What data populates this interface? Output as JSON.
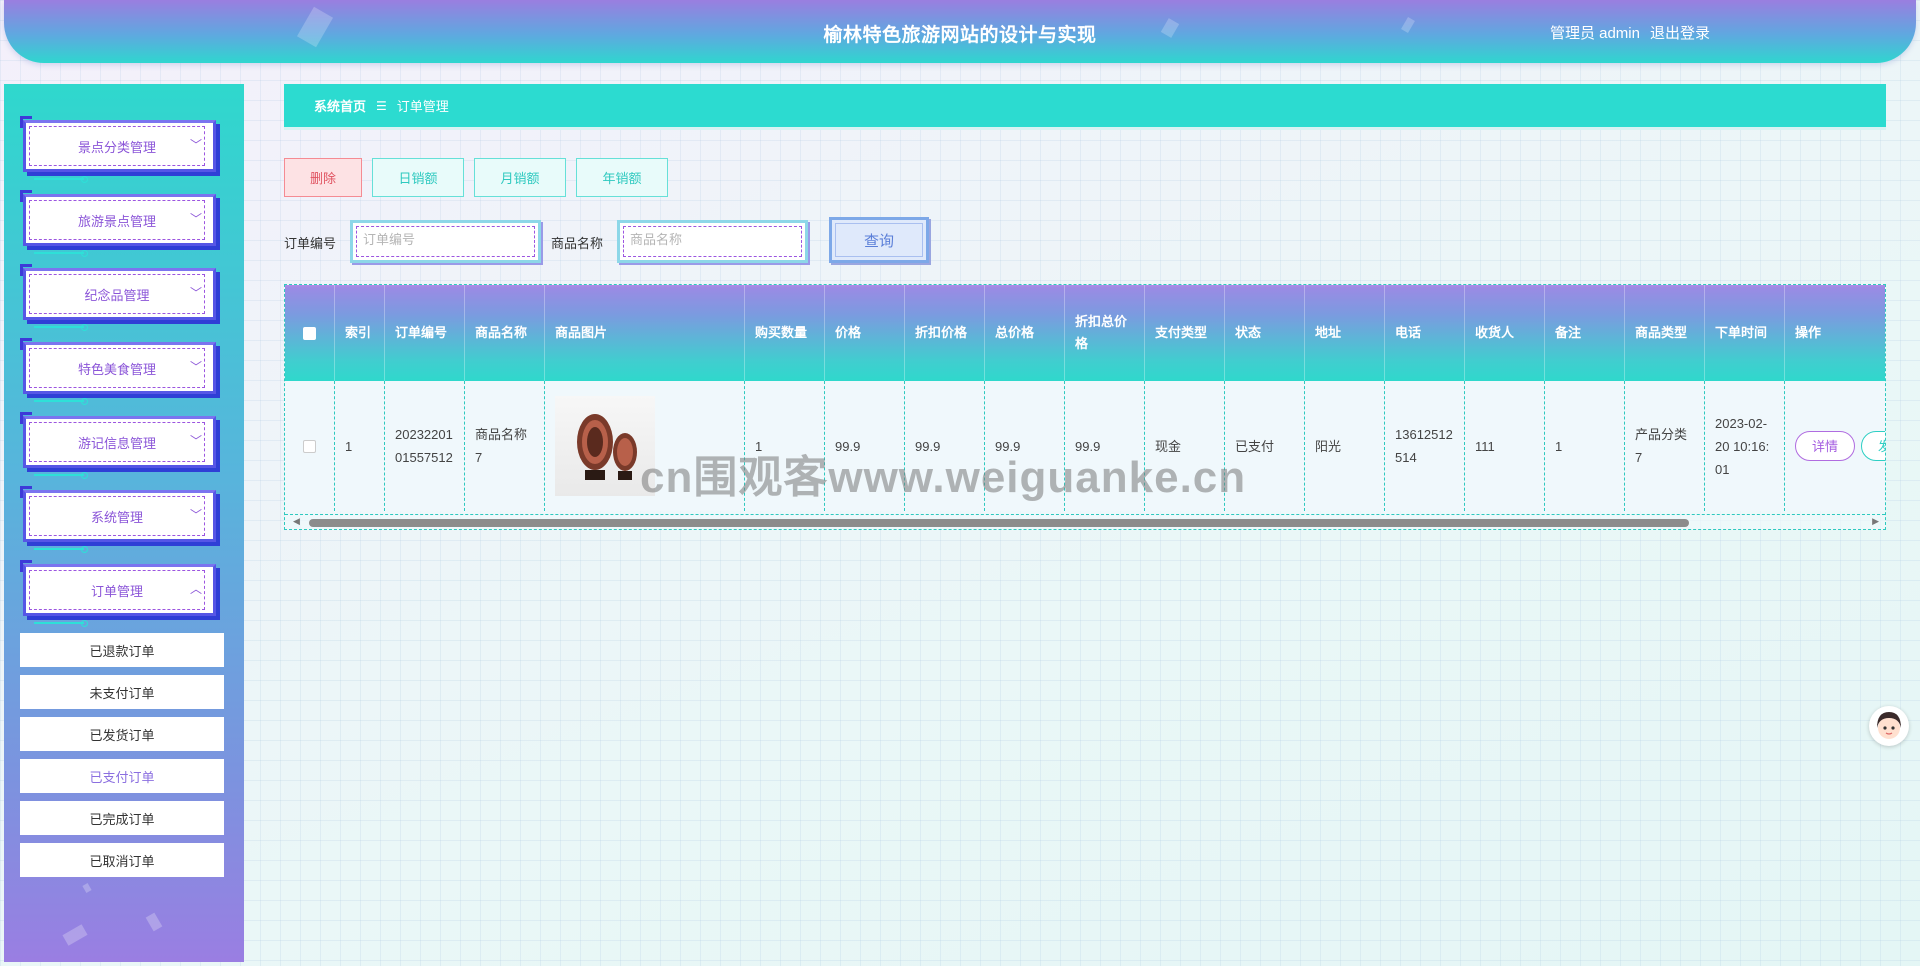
{
  "header": {
    "title": "榆林特色旅游网站的设计与实现",
    "user_label": "管理员 admin",
    "logout_label": "退出登录"
  },
  "sidebar": {
    "menus": [
      {
        "label": "景点分类管理",
        "chevron": "chevron-down-icon"
      },
      {
        "label": "旅游景点管理",
        "chevron": "chevron-down-icon"
      },
      {
        "label": "纪念品管理",
        "chevron": "chevron-down-icon"
      },
      {
        "label": "特色美食管理",
        "chevron": "chevron-down-icon"
      },
      {
        "label": "游记信息管理",
        "chevron": "chevron-down-icon"
      },
      {
        "label": "系统管理",
        "chevron": "chevron-down-icon"
      },
      {
        "label": "订单管理",
        "chevron": "chevron-up-icon"
      }
    ],
    "submenu": [
      {
        "label": "已退款订单",
        "active": false
      },
      {
        "label": "未支付订单",
        "active": false
      },
      {
        "label": "已发货订单",
        "active": false
      },
      {
        "label": "已支付订单",
        "active": true
      },
      {
        "label": "已完成订单",
        "active": false
      },
      {
        "label": "已取消订单",
        "active": false
      }
    ]
  },
  "breadcrumb": {
    "home": "系统首页",
    "separator": "☰",
    "current": "订单管理"
  },
  "toolbar": {
    "delete_label": "删除",
    "daily_label": "日销额",
    "monthly_label": "月销额",
    "yearly_label": "年销额"
  },
  "search": {
    "order_no_label": "订单编号",
    "order_no_placeholder": "订单编号",
    "product_name_label": "商品名称",
    "product_name_placeholder": "商品名称",
    "query_label": "查询"
  },
  "table": {
    "headers": [
      "索引",
      "订单编号",
      "商品名称",
      "商品图片",
      "购买数量",
      "价格",
      "折扣价格",
      "总价格",
      "折扣总价格",
      "支付类型",
      "状态",
      "地址",
      "电话",
      "收货人",
      "备注",
      "商品类型",
      "下单时间",
      "操作"
    ],
    "rows": [
      {
        "index": "1",
        "order_no": "2023220101557512",
        "product_name": "商品名称7",
        "product_image": "vase-pair-image",
        "quantity": "1",
        "price": "99.9",
        "discount_price": "99.9",
        "total_price": "99.9",
        "discount_total": "99.9",
        "pay_type": "现金",
        "status": "已支付",
        "address": "阳光",
        "phone": "13612512514",
        "receiver": "111",
        "remark": "1",
        "product_type": "产品分类7",
        "order_time": "2023-02-20 10:16:01",
        "detail_label": "详情",
        "edit_label": "发"
      }
    ]
  },
  "watermark": "cn围观客www.weiguanke.cn",
  "colors": {
    "accent_teal": "#2cdbd0",
    "accent_purple": "#8b55d8",
    "delete_red": "#e05260"
  }
}
